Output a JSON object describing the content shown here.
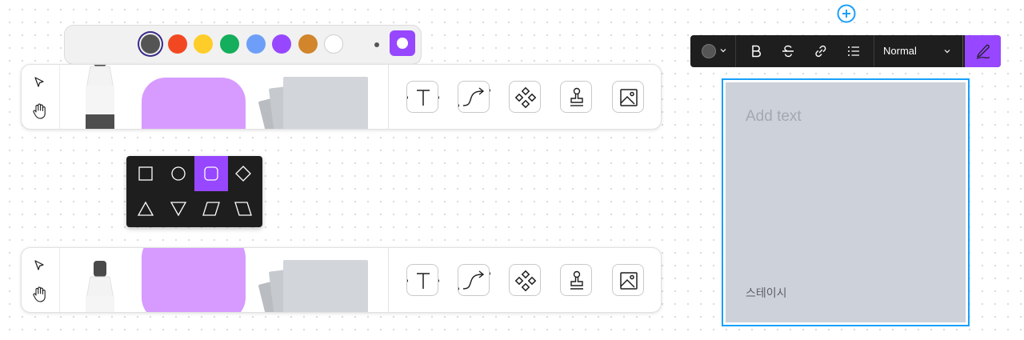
{
  "palette": {
    "colors": [
      {
        "name": "dark-gray",
        "hex": "#545454",
        "selected": true
      },
      {
        "name": "red",
        "hex": "#f24822"
      },
      {
        "name": "yellow",
        "hex": "#ffcd29"
      },
      {
        "name": "green",
        "hex": "#14ae5c"
      },
      {
        "name": "blue",
        "hex": "#6d9ff8"
      },
      {
        "name": "violet",
        "hex": "#9747ff"
      },
      {
        "name": "orange",
        "hex": "#d2852a"
      },
      {
        "name": "white",
        "hex": "#ffffff"
      }
    ],
    "stroke_size_options": [
      "small",
      "large"
    ],
    "selected_stroke_size": "large"
  },
  "toolbars": [
    {
      "left_tools": [
        "select-arrow-icon",
        "hand-icon"
      ],
      "items": [
        "marker",
        "shape",
        "sticky-stack"
      ],
      "buttons": [
        "text-tool-icon",
        "connector-tool-icon",
        "components-icon",
        "stamp-icon",
        "image-icon"
      ]
    },
    {
      "left_tools": [
        "select-arrow-icon",
        "hand-icon"
      ],
      "items": [
        "marker",
        "shape",
        "sticky-stack"
      ],
      "buttons": [
        "text-tool-icon",
        "connector-tool-icon",
        "components-icon",
        "stamp-icon",
        "image-icon"
      ]
    }
  ],
  "shape_picker": {
    "shapes": [
      "square",
      "circle",
      "rounded-square",
      "diamond",
      "triangle-up",
      "triangle-down",
      "parallelogram-right",
      "parallelogram-left"
    ],
    "selected": "rounded-square"
  },
  "add_button_icon": "plus-circle-icon",
  "format_bar": {
    "color_icon": "color-dot-icon",
    "bold_icon": "bold-icon",
    "strike_icon": "strikethrough-icon",
    "link_icon": "link-icon",
    "list_icon": "bullet-list-icon",
    "text_style": "Normal",
    "pen_icon": "signature-pen-icon",
    "accent": "#9747ff"
  },
  "sticky_note": {
    "placeholder": "Add text",
    "author": "스테이시",
    "background": "#cdd1d9",
    "selection_color": "#18a0fb"
  }
}
